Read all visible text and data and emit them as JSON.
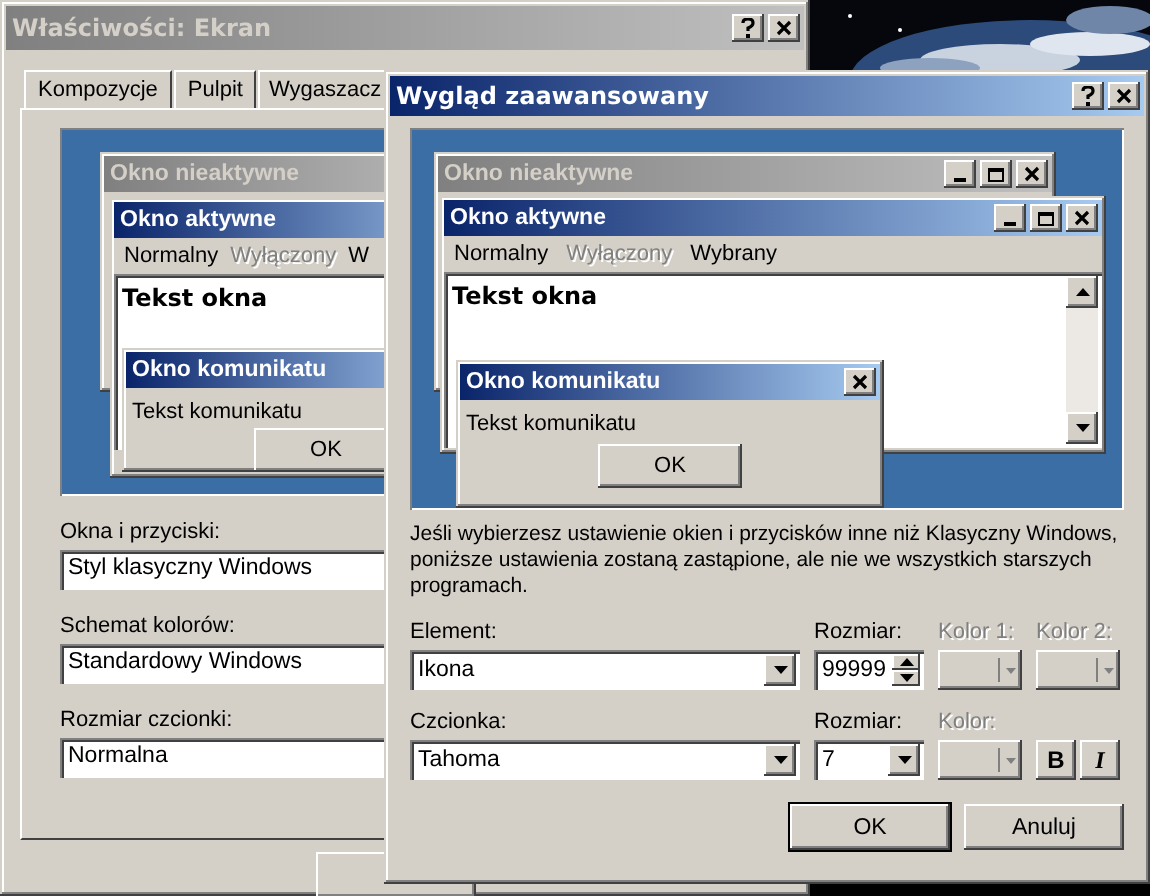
{
  "properties_window": {
    "title": "Właściwości: Ekran",
    "active": false,
    "tabs": [
      {
        "label": "Kompozycje",
        "selected": false
      },
      {
        "label": "Pulpit",
        "selected": false
      },
      {
        "label": "Wygaszacz",
        "selected": false
      }
    ],
    "preview": {
      "inactive_title": "Okno nieaktywne",
      "active_title": "Okno aktywne",
      "menu": [
        {
          "label": "Normalny",
          "disabled": false
        },
        {
          "label": "Wyłączony",
          "disabled": true
        },
        {
          "label": "W",
          "disabled": false
        }
      ],
      "window_text": "Tekst okna",
      "message_title": "Okno komunikatu",
      "message_text": "Tekst komunikatu",
      "ok": "OK"
    },
    "fields": [
      {
        "label": "Okna i przyciski:",
        "value": "Styl klasyczny Windows"
      },
      {
        "label": "Schemat kolorów:",
        "value": "Standardowy Windows"
      },
      {
        "label": "Rozmiar czcionki:",
        "value": "Normalna"
      }
    ]
  },
  "advanced_window": {
    "title": "Wygląd zaawansowany",
    "active": true,
    "preview": {
      "inactive_title": "Okno nieaktywne",
      "active_title": "Okno aktywne",
      "menu": [
        {
          "label": "Normalny",
          "disabled": false
        },
        {
          "label": "Wyłączony",
          "disabled": true
        },
        {
          "label": "Wybrany",
          "disabled": false
        }
      ],
      "window_text": "Tekst okna",
      "message_title": "Okno komunikatu",
      "message_text": "Tekst komunikatu",
      "ok": "OK",
      "caption_buttons": true,
      "scrollbar": true
    },
    "note": "Jeśli wybierzesz ustawienie okien i przycisków inne niż Klasyczny Windows, poniższe ustawienia zostaną zastąpione, ale nie we wszystkich starszych programach.",
    "rows": [
      {
        "fields": [
          {
            "kind": "combo",
            "label": "Element:",
            "value": "Ikona",
            "disabled": false
          },
          {
            "kind": "spin",
            "label": "Rozmiar:",
            "value": "99999",
            "disabled": false
          },
          {
            "kind": "color",
            "label": "Kolor 1:",
            "disabled": true
          },
          {
            "kind": "color",
            "label": "Kolor 2:",
            "disabled": true
          }
        ]
      },
      {
        "fields": [
          {
            "kind": "combo",
            "label": "Czcionka:",
            "value": "Tahoma",
            "disabled": false
          },
          {
            "kind": "combo",
            "label": "Rozmiar:",
            "value": "7",
            "disabled": false
          },
          {
            "kind": "color",
            "label": "Kolor:",
            "disabled": true
          },
          {
            "kind": "style",
            "buttons": [
              "B",
              "I"
            ]
          }
        ]
      }
    ],
    "buttons": [
      "OK",
      "Anuluj"
    ]
  }
}
